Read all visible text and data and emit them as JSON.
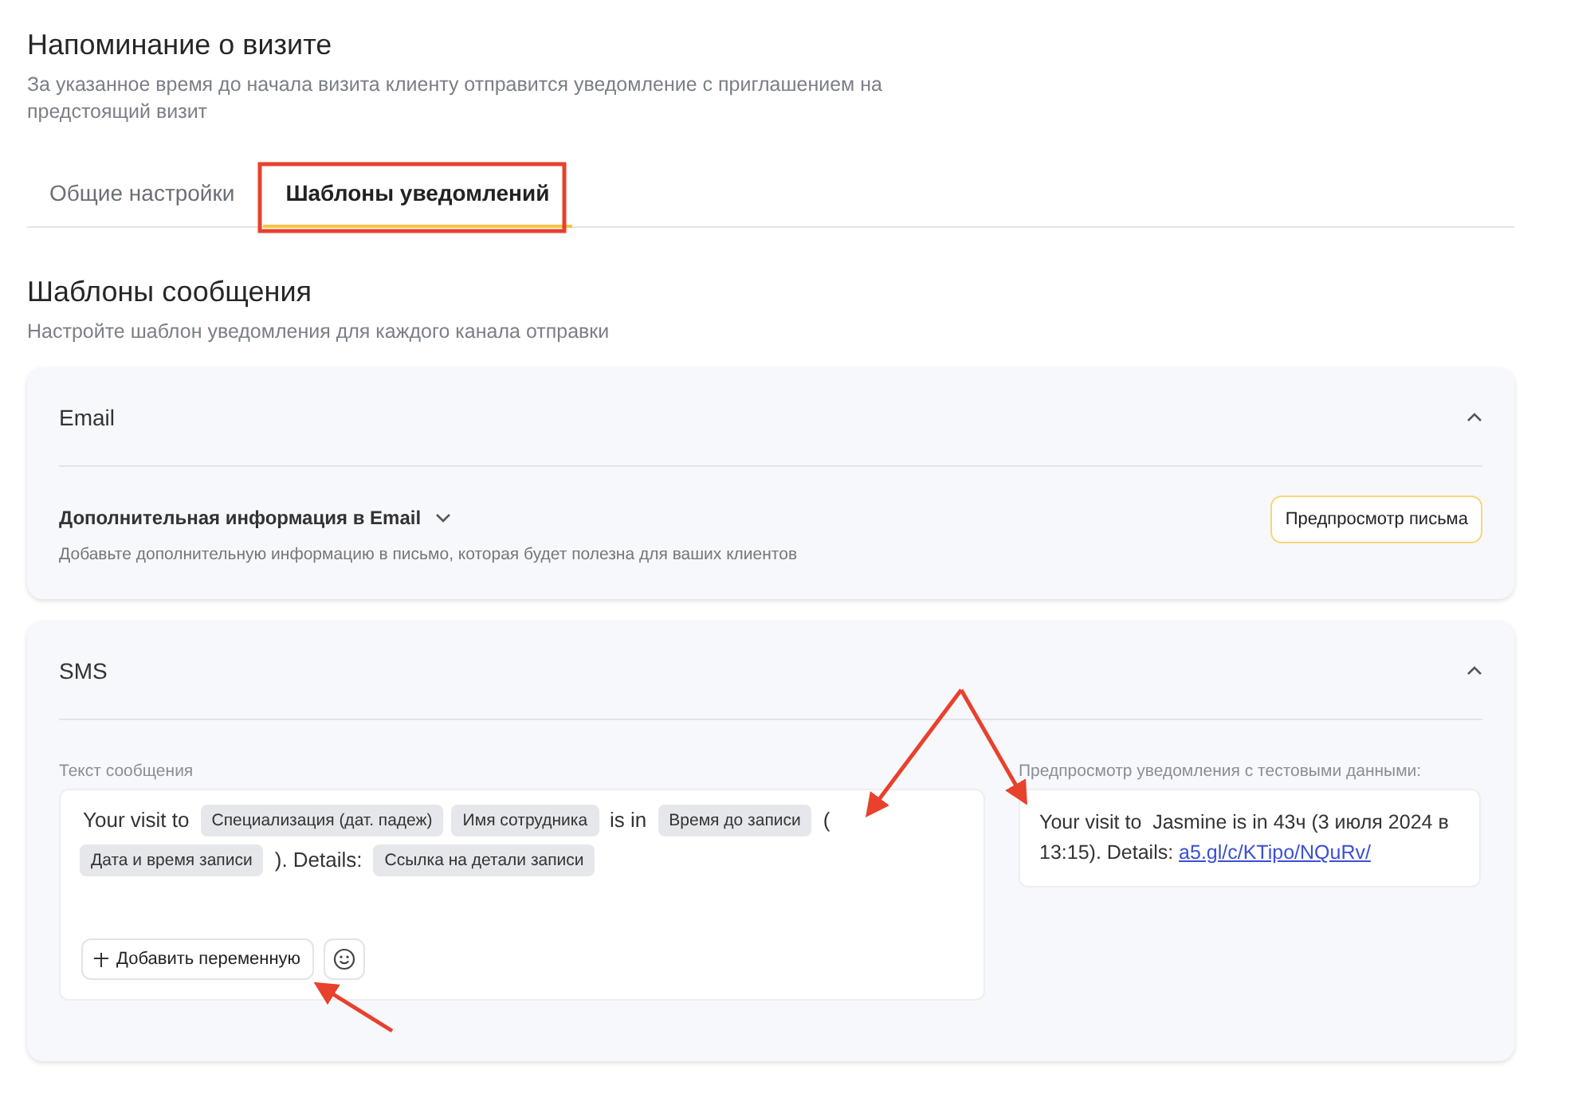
{
  "title": "Напоминание о визите",
  "description": "За указанное время до начала визита клиенту отправится уведомление с приглашением на предстоящий визит",
  "tabs": [
    {
      "label": "Общие настройки",
      "selected": false
    },
    {
      "label": "Шаблоны уведомлений",
      "selected": true
    }
  ],
  "section": {
    "title": "Шаблоны сообщения",
    "description": "Настройте шаблон уведомления для каждого канала отправки"
  },
  "channels": [
    {
      "kind": "email",
      "name": "Email",
      "expanded": true,
      "extra": {
        "title": "Дополнительная информация в Email",
        "expanded": false,
        "description": "Добавьте дополнительную информацию в письмо, которая будет полезна для ваших клиентов",
        "button": "Предпросмотр письма"
      }
    },
    {
      "kind": "sms",
      "name": "SMS",
      "expanded": true,
      "editor_label": "Текст сообщения",
      "template": [
        {
          "kind": "text",
          "text": "Your visit to"
        },
        {
          "kind": "variable",
          "text": "Специализация (дат. падеж)"
        },
        {
          "kind": "variable",
          "text": "Имя сотрудника"
        },
        {
          "kind": "text",
          "text": "is in"
        },
        {
          "kind": "variable",
          "text": "Время до записи"
        },
        {
          "kind": "text",
          "text": "("
        },
        {
          "kind": "variable",
          "text": "Дата и время записи"
        },
        {
          "kind": "text",
          "text": "). Details:"
        },
        {
          "kind": "variable",
          "text": "Ссылка на детали записи"
        }
      ],
      "add_variable": "Добавить переменную",
      "preview_label": "Предпросмотр уведомления с тестовыми данными:",
      "preview": [
        {
          "kind": "text",
          "text": "Your visit to  Jasmine is in 43ч (3 июля 2024 в 13:15). Details: "
        },
        {
          "kind": "link",
          "text": "a5.gl/c/KTipo/NQuRv/"
        }
      ]
    }
  ]
}
